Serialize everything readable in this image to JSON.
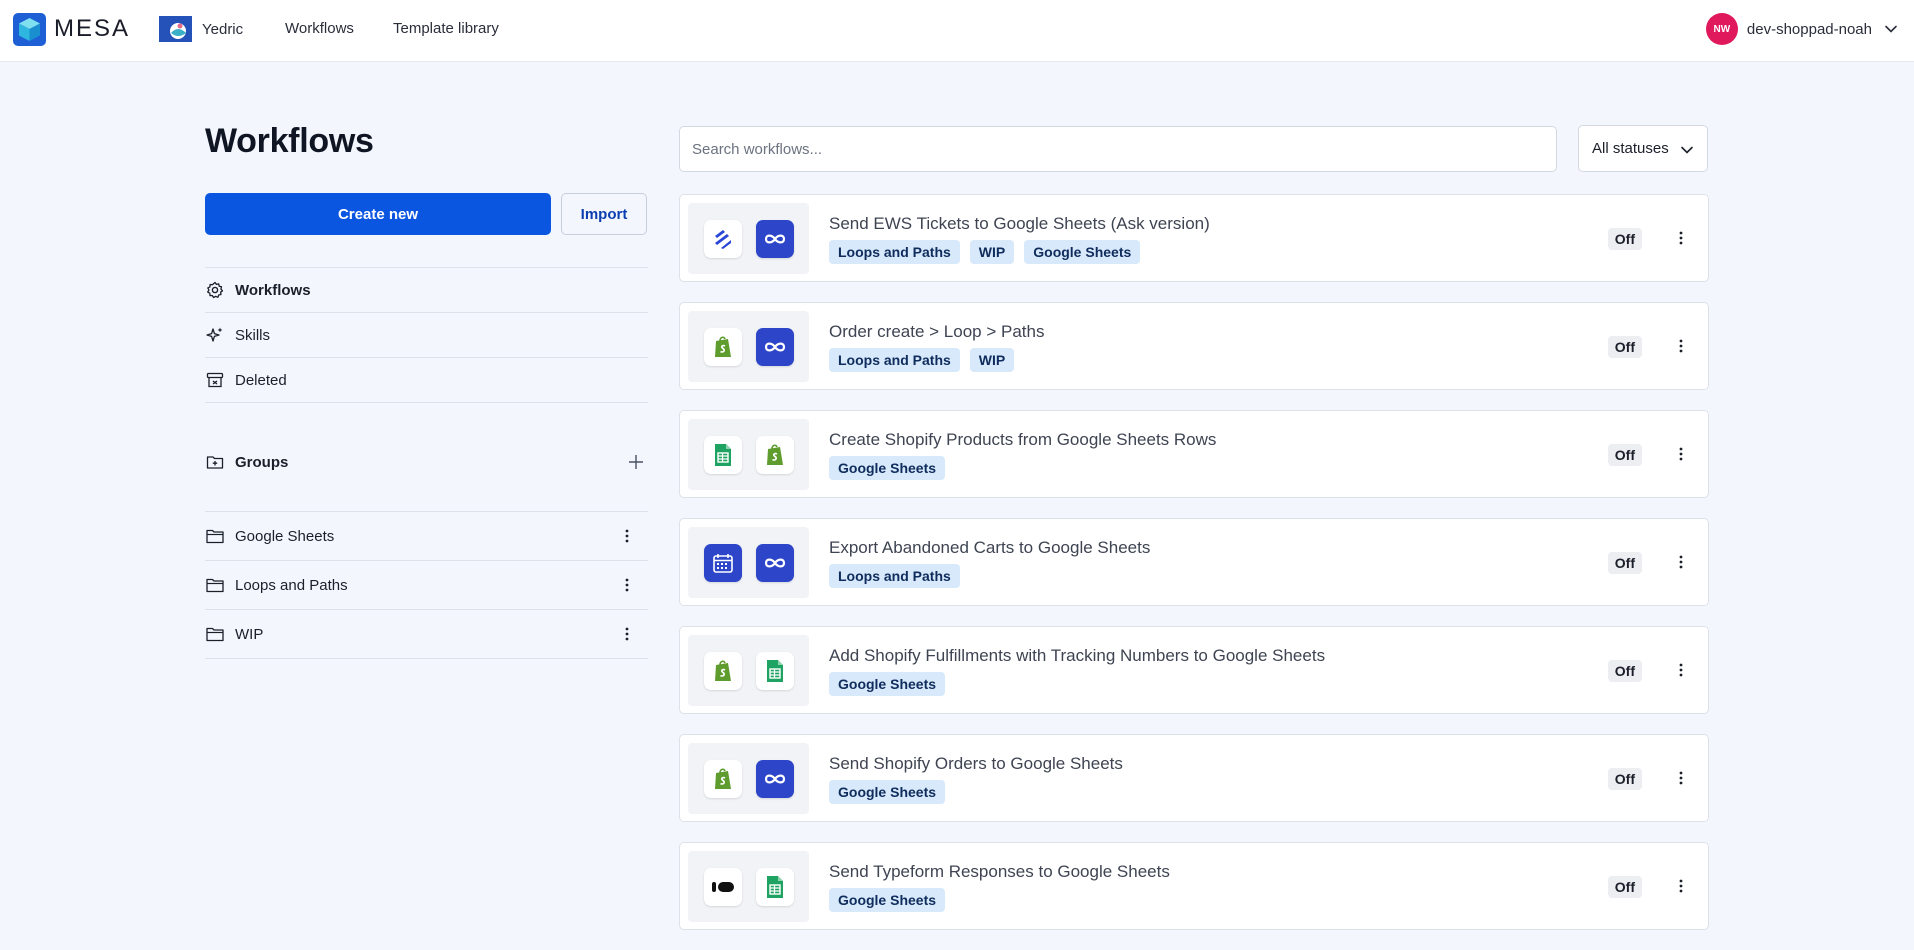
{
  "header": {
    "brand_name": "MESA",
    "store_name": "Yedric",
    "nav": [
      "Workflows",
      "Template library"
    ],
    "user_initials": "NW",
    "user_name": "dev-shoppad-noah"
  },
  "sidebar": {
    "title": "Workflows",
    "create_label": "Create new",
    "import_label": "Import",
    "items": [
      {
        "label": "Workflows",
        "icon": "gear-icon",
        "active": true
      },
      {
        "label": "Skills",
        "icon": "sparkle-icon",
        "active": false
      },
      {
        "label": "Deleted",
        "icon": "archive-icon",
        "active": false
      }
    ],
    "groups_label": "Groups",
    "groups": [
      "Google Sheets",
      "Loops and Paths",
      "WIP"
    ]
  },
  "main": {
    "search_placeholder": "Search workflows...",
    "status_filter": "All statuses",
    "workflows": [
      {
        "title": "Send EWS Tickets to Google Sheets (Ask version)",
        "tags": [
          "Loops and Paths",
          "WIP",
          "Google Sheets"
        ],
        "status": "Off",
        "apps": [
          "zendesk-icon",
          "loop-icon"
        ]
      },
      {
        "title": "Order create > Loop > Paths",
        "tags": [
          "Loops and Paths",
          "WIP"
        ],
        "status": "Off",
        "apps": [
          "shopify-icon",
          "loop-icon"
        ]
      },
      {
        "title": "Create Shopify Products from Google Sheets Rows",
        "tags": [
          "Google Sheets"
        ],
        "status": "Off",
        "apps": [
          "google-sheets-icon",
          "shopify-icon"
        ]
      },
      {
        "title": "Export Abandoned Carts to Google Sheets",
        "tags": [
          "Loops and Paths"
        ],
        "status": "Off",
        "apps": [
          "calendar-icon",
          "loop-icon"
        ]
      },
      {
        "title": "Add Shopify Fulfillments with Tracking Numbers to Google Sheets",
        "tags": [
          "Google Sheets"
        ],
        "status": "Off",
        "apps": [
          "shopify-icon",
          "google-sheets-icon"
        ]
      },
      {
        "title": "Send Shopify Orders to Google Sheets",
        "tags": [
          "Google Sheets"
        ],
        "status": "Off",
        "apps": [
          "shopify-icon",
          "loop-icon"
        ]
      },
      {
        "title": "Send Typeform Responses to Google Sheets",
        "tags": [
          "Google Sheets"
        ],
        "status": "Off",
        "apps": [
          "typeform-icon",
          "google-sheets-icon"
        ]
      }
    ]
  }
}
